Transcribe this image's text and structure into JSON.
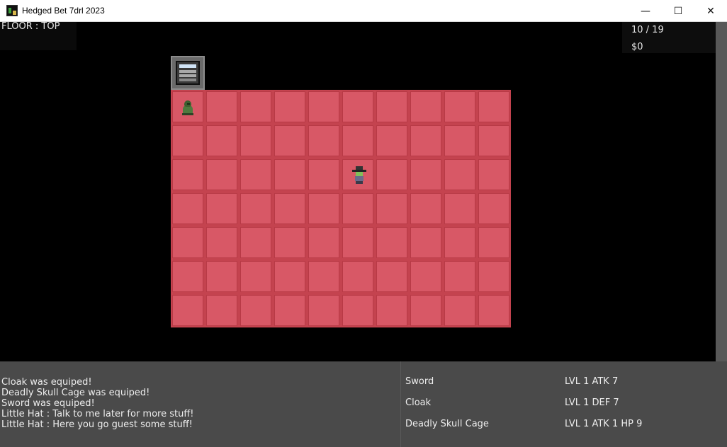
{
  "window": {
    "title": "Hedged Bet 7drl 2023",
    "minimize_glyph": "—",
    "maximize_glyph": "☐",
    "close_glyph": "✕"
  },
  "hud_top": {
    "floor_label": "FLOOR : TOP",
    "hp": "10 / 19",
    "money": "$0"
  },
  "board": {
    "columns": 10,
    "rows": 7,
    "tile_color": "#d85866",
    "entities": [
      {
        "name": "hooded-figure",
        "col": 0,
        "row": 0
      },
      {
        "name": "player",
        "col": 5,
        "row": 2
      }
    ],
    "stairs": {
      "col": 0,
      "row": -1
    }
  },
  "log": {
    "lines": [
      "Cloak was equiped!",
      "Deadly Skull Cage was equiped!",
      "Sword was equiped!",
      "Little Hat : Talk to me later for more stuff!",
      "Little Hat : Here you go guest some stuff!"
    ]
  },
  "equipment": {
    "items": [
      {
        "name": "Sword",
        "stats": "LVL 1 ATK 7"
      },
      {
        "name": "Cloak",
        "stats": "LVL 1 DEF 7"
      },
      {
        "name": "Deadly Skull Cage",
        "stats": "LVL 1 ATK 1 HP 9"
      }
    ]
  }
}
